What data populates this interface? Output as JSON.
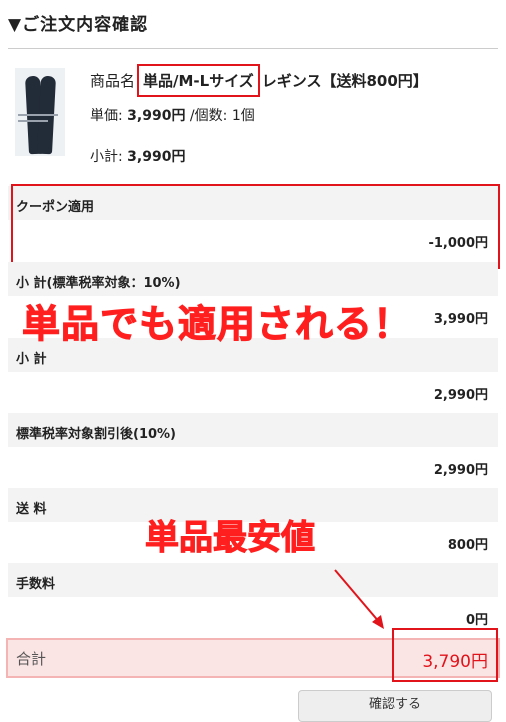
{
  "section": {
    "title": "▼ご注文内容確認"
  },
  "product": {
    "name_label": "商品名",
    "variant": "単品/M-Lサイズ",
    "name_rest": "レギンス【送料800円】",
    "price_label": "単価:",
    "price_value": "3,990円",
    "qty_label": "/個数:",
    "qty_value": "1個",
    "subtotal_label": "小計:",
    "subtotal_value": "3,990円",
    "image_icon": "leggings-photo"
  },
  "summary": {
    "coupon": {
      "label": "クーポン適用",
      "value": "-1,000円"
    },
    "subtotal_tax": {
      "label": "小 計(標準税率対象：10%)",
      "value": "3,990円"
    },
    "subtotal": {
      "label": "小 計",
      "value": "2,990円"
    },
    "discounted": {
      "label": "標準税率対象割引後(10%)",
      "value": "2,990円"
    },
    "shipping": {
      "label": "送 料",
      "value": "800円"
    },
    "fee": {
      "label": "手数料",
      "value": "0円"
    },
    "total": {
      "label": "合計",
      "value": "3,790円"
    }
  },
  "annotations": {
    "applies_single": "単品でも適用される！",
    "lowest_price": "単品最安値"
  },
  "button": {
    "confirm_label": "確認する"
  },
  "colors": {
    "accent_red": "#e1141b",
    "row_bg": "#f3f3f3",
    "total_bg": "#fbe4e4"
  }
}
